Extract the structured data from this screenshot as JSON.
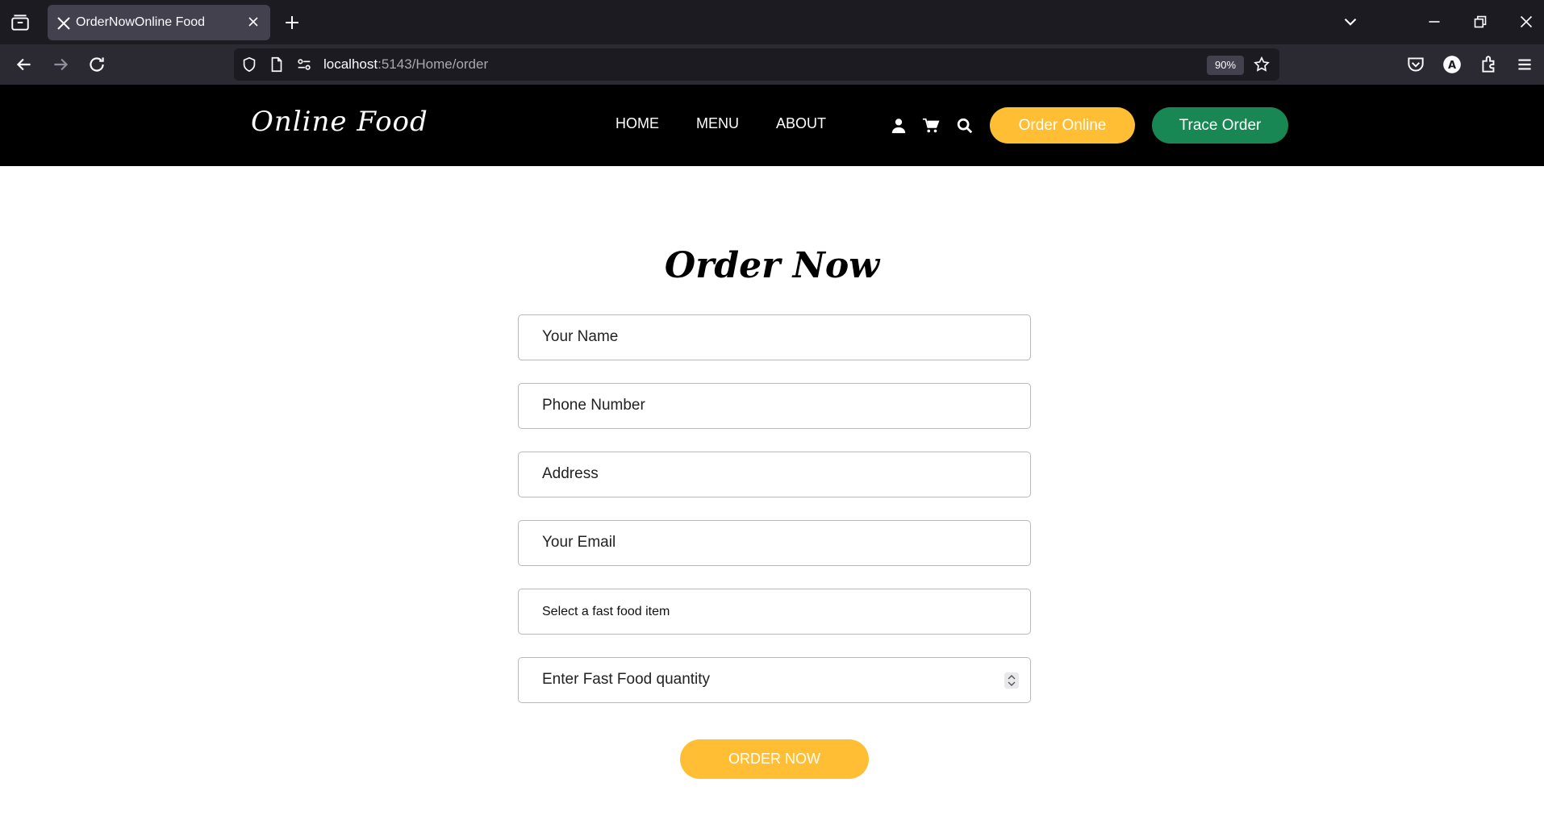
{
  "browser": {
    "tab_title": "OrderNowOnline Food",
    "url_host": "localhost",
    "url_rest": ":5143/Home/order",
    "zoom": "90%"
  },
  "site": {
    "brand": "Online Food",
    "nav": [
      "HOME",
      "MENU",
      "ABOUT"
    ],
    "order_online_label": "Order Online",
    "trace_order_label": "Trace Order"
  },
  "form": {
    "title": "Order Now",
    "fields": {
      "name": "Your Name",
      "phone": "Phone Number",
      "address": "Address",
      "email": "Your Email",
      "food_select": "Select a fast food item",
      "quantity": "Enter Fast Food quantity"
    },
    "submit_label": "ORDER NOW"
  },
  "colors": {
    "accent_yellow": "#ffbe33",
    "accent_green": "#198754",
    "header_bg": "#000000"
  }
}
